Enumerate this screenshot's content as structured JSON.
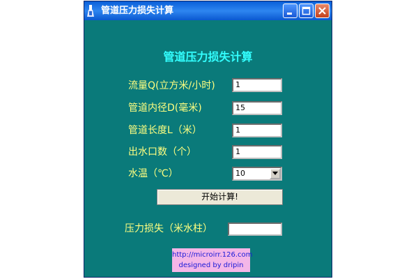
{
  "window": {
    "title": "管道压力损失计算",
    "icon": "app-icon",
    "controls": [
      "minimize-icon",
      "maximize-icon",
      "close-icon"
    ]
  },
  "form": {
    "heading": "管道压力损失计算",
    "fields": [
      {
        "label": "流量Q(立方米/小时)",
        "value": "1"
      },
      {
        "label": "管道内径D(毫米)",
        "value": "15"
      },
      {
        "label": "管道长度L（米）",
        "value": "1"
      },
      {
        "label": "出水口数（个）",
        "value": "1"
      }
    ],
    "water_temp": {
      "label": "水温（℃）",
      "selected": "10"
    },
    "calc_button": "开始计算!",
    "result": {
      "label": "压力损失（米水柱）",
      "value": ""
    }
  },
  "credit": {
    "line1": "http://microirr.126.com",
    "line2": "designed  by  dripin"
  },
  "colors": {
    "background": "#0a7a7a",
    "label": "#ffff80",
    "heading": "#33ffff",
    "credit_bg": "#f4b6e8",
    "credit_text": "#1a1ad8"
  }
}
